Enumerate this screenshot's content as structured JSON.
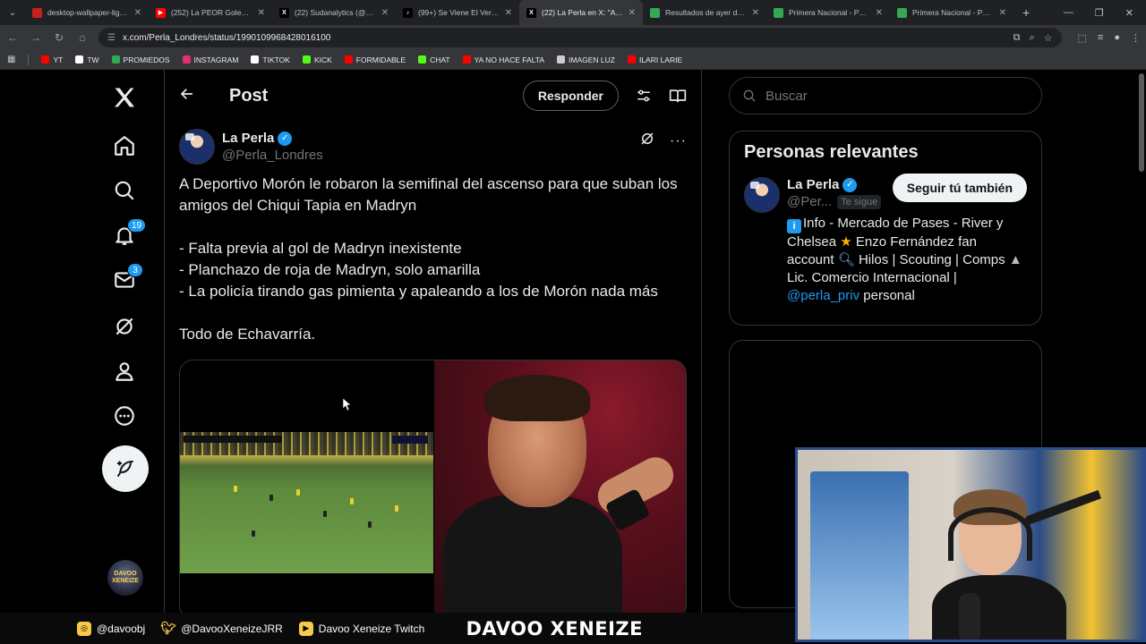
{
  "browser": {
    "tabs": [
      {
        "title": "desktop-wallpaper-light-…",
        "color": "#c5221f",
        "glyph": ""
      },
      {
        "title": "(252) La PEOR Goleada S…",
        "color": "#ff0000",
        "glyph": "▶"
      },
      {
        "title": "(22) Sudanalytics (@suda…",
        "color": "#000000",
        "glyph": "X"
      },
      {
        "title": "(99+) Se Viene El Verano",
        "color": "#000000",
        "glyph": "♪"
      },
      {
        "title": "(22) La Perla en X: \"A Dep…",
        "color": "#000000",
        "glyph": "X",
        "active": true
      },
      {
        "title": "Resultados de ayer del Fú…",
        "color": "#34a853",
        "glyph": ""
      },
      {
        "title": "Primera Nacional - POSIC…",
        "color": "#34a853",
        "glyph": ""
      },
      {
        "title": "Primera Nacional - POSIC…",
        "color": "#34a853",
        "glyph": ""
      }
    ],
    "url": "x.com/Perla_Londres/status/1990109968428016100",
    "bookmarks": [
      {
        "label": "YT",
        "color": "#ff0000"
      },
      {
        "label": "TW",
        "color": "#ffffff"
      },
      {
        "label": "PROMIEDOS",
        "color": "#34a853"
      },
      {
        "label": "INSTAGRAM",
        "color": "#e1306c"
      },
      {
        "label": "TIKTOK",
        "color": "#ffffff"
      },
      {
        "label": "KICK",
        "color": "#53fc18"
      },
      {
        "label": "FORMIDABLE",
        "color": "#ff0000"
      },
      {
        "label": "CHAT",
        "color": "#53fc18"
      },
      {
        "label": "YA NO HACE FALTA",
        "color": "#ff0000"
      },
      {
        "label": "IMAGEN LUZ",
        "color": "#cccccc"
      },
      {
        "label": "ILARI LARIE",
        "color": "#ff0000"
      }
    ]
  },
  "nav": {
    "notifications_badge": "19",
    "messages_badge": "3",
    "avatar_text": "DAVOO XENEIZE"
  },
  "header": {
    "title": "Post",
    "reply_label": "Responder"
  },
  "tweet": {
    "author_name": "La Perla",
    "author_handle": "@Perla_Londres",
    "paragraph1": "A Deportivo Morón le robaron la semifinal del ascenso para que suban los amigos del Chiqui Tapia en Madryn",
    "line1": "- Falta previa al gol de Madryn inexistente",
    "line2": "- Planchazo de roja de Madryn, solo amarilla",
    "line3": "- La policía tirando gas pimienta y apaleando a los de Morón nada más",
    "closing": "Todo de Echavarría."
  },
  "sidebar": {
    "search_placeholder": "Buscar",
    "relevant_title": "Personas relevantes",
    "person": {
      "name": "La Perla",
      "handle": "@Per...",
      "follows_you": "Te sigue",
      "follow_label": "Seguir tú también",
      "bio_1": "Info - Mercado de Pases - River y Chelsea",
      "bio_2": "Enzo Fernández fan account",
      "bio_3": "Hilos | Scouting | Comps",
      "bio_4": "Lic. Comercio Internacional |",
      "bio_mention": "@perla_priv",
      "bio_5": "personal"
    }
  },
  "overlay": {
    "instagram": "@davoobj",
    "twitter": "@DavooXeneizeJRR",
    "twitch": "Davoo Xeneize Twitch",
    "brand": "DAVOO XENEIZE"
  },
  "colors": {
    "accent": "#1d9bf0",
    "background": "#000000",
    "border": "#2f3336"
  }
}
